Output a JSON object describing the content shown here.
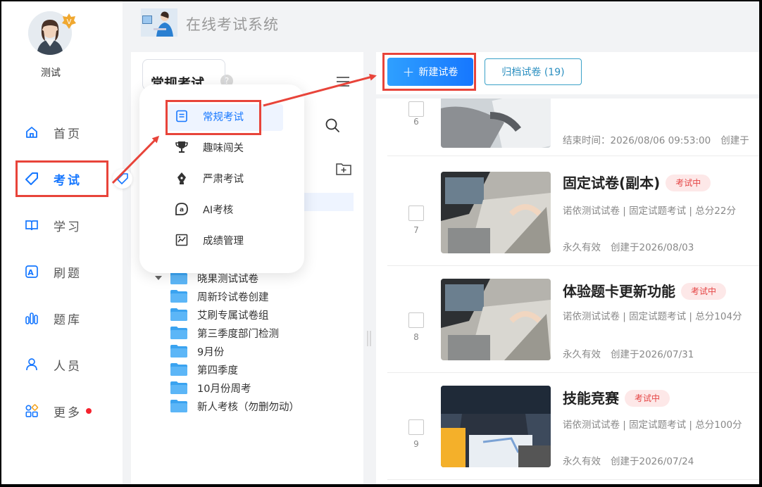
{
  "user": {
    "name": "测试"
  },
  "header": {
    "title": "在线考试系统"
  },
  "nav": {
    "items": [
      {
        "label": "首页",
        "icon": "home-icon"
      },
      {
        "label": "考试",
        "icon": "tag-icon",
        "active": true
      },
      {
        "label": "学习",
        "icon": "book-icon"
      },
      {
        "label": "刷题",
        "icon": "letter-a-icon"
      },
      {
        "label": "题库",
        "icon": "bars-icon"
      },
      {
        "label": "人员",
        "icon": "person-icon"
      },
      {
        "label": "更多",
        "icon": "apps-icon",
        "dot": true
      }
    ]
  },
  "midpanel": {
    "title": "常规考试",
    "help": "?",
    "folders": [
      "晓果测试试卷",
      "周新玲试卷创建",
      "艾刷专属试卷组",
      "第三季度部门检测",
      "9月份",
      "第四季度",
      "10月份周考",
      "新人考核（勿删勿动）"
    ]
  },
  "popup": {
    "items": [
      {
        "label": "常规考试",
        "icon": "document-icon",
        "active": true
      },
      {
        "label": "趣味闯关",
        "icon": "trophy-icon"
      },
      {
        "label": "严肃考试",
        "icon": "pen-nib-icon"
      },
      {
        "label": "AI考核",
        "icon": "ai-chat-icon"
      },
      {
        "label": "成绩管理",
        "icon": "chart-doc-icon"
      }
    ]
  },
  "toolbar": {
    "new_label": "新建试卷",
    "archive_label": "归档试卷 (19)"
  },
  "exams": [
    {
      "num": "6",
      "title": "",
      "status": "",
      "meta": "",
      "validity": "",
      "created": "",
      "end_time": "结束时间：2026/08/06 09:53:00",
      "created_trunc": "创建于"
    },
    {
      "num": "7",
      "title": "固定试卷(副本)",
      "status": "考试中",
      "meta": "诺依测试试卷 | 固定试题考试 | 总分22分",
      "validity": "永久有效",
      "created": "创建于2026/08/03"
    },
    {
      "num": "8",
      "title": "体验题卡更新功能",
      "status": "考试中",
      "meta": "诺依测试试卷 | 固定试题考试 | 总分104分",
      "validity": "永久有效",
      "created": "创建于2026/07/31"
    },
    {
      "num": "9",
      "title": "技能竞赛",
      "status": "考试中",
      "meta": "诺依测试试卷 | 固定试题考试 | 总分100分",
      "validity": "永久有效",
      "created": "创建于2026/07/24"
    }
  ],
  "colors": {
    "accent": "#1677ff",
    "annotation": "#e8443a",
    "badge_bg": "#fde8e8",
    "badge_text": "#e54545"
  }
}
